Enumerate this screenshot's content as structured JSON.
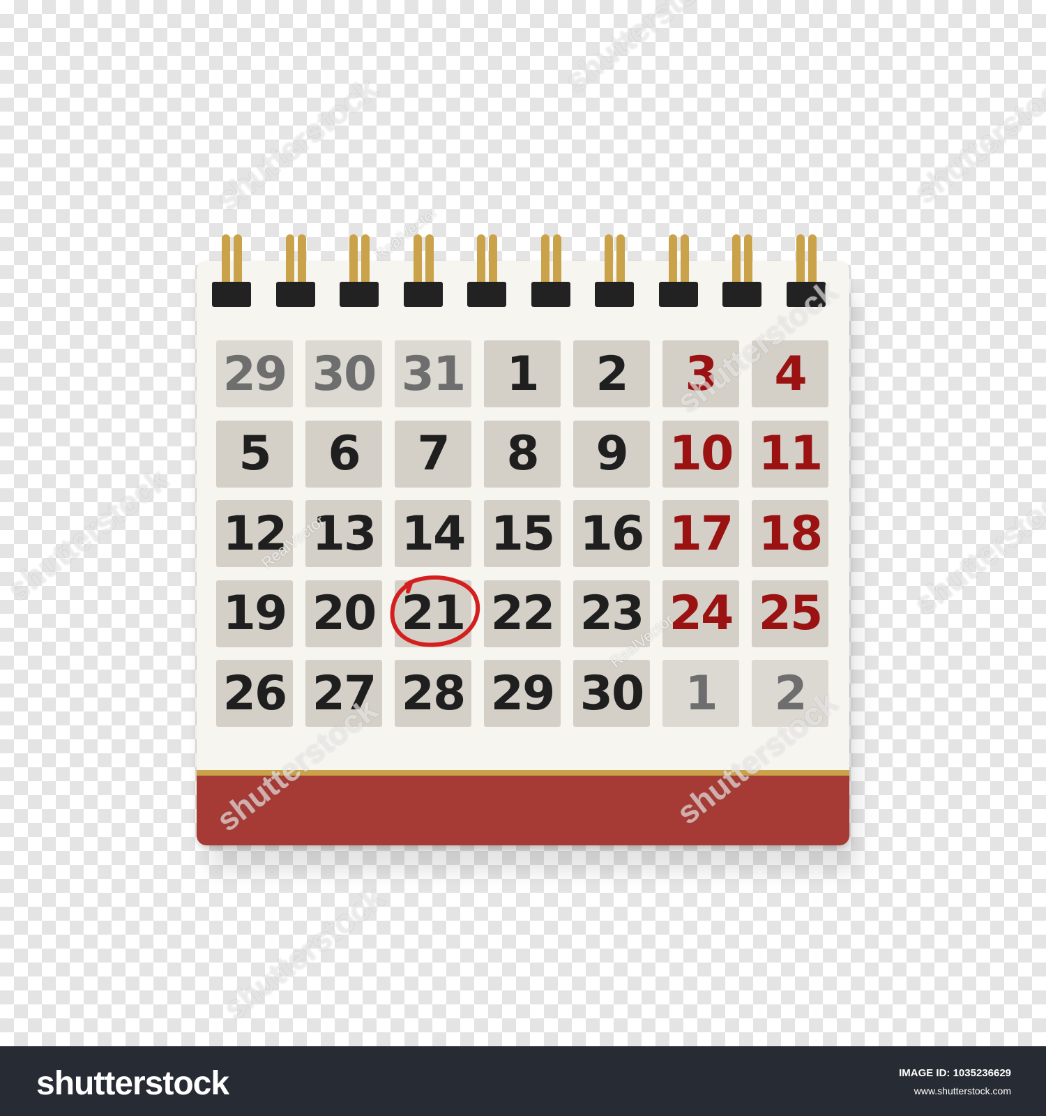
{
  "colors": {
    "paper": "#f7f5f0",
    "cell_bg": "#d4d0c7",
    "cell_bg_dim": "#dcd9d2",
    "text_dark": "#1f1f1f",
    "text_grey": "#6e6e6e",
    "text_red": "#9a1212",
    "ring_gold": "#c9a24a",
    "clip_black": "#222222",
    "footer_red": "#a63a34",
    "gold_line": "#c9a24a",
    "circle_red": "#d41f1f"
  },
  "calendar": {
    "rows": [
      [
        {
          "label": "29",
          "state": "outside"
        },
        {
          "label": "30",
          "state": "outside"
        },
        {
          "label": "31",
          "state": "outside"
        },
        {
          "label": "1",
          "state": "weekday"
        },
        {
          "label": "2",
          "state": "weekday"
        },
        {
          "label": "3",
          "state": "weekend"
        },
        {
          "label": "4",
          "state": "weekend"
        }
      ],
      [
        {
          "label": "5",
          "state": "weekday"
        },
        {
          "label": "6",
          "state": "weekday"
        },
        {
          "label": "7",
          "state": "weekday"
        },
        {
          "label": "8",
          "state": "weekday"
        },
        {
          "label": "9",
          "state": "weekday"
        },
        {
          "label": "10",
          "state": "weekend"
        },
        {
          "label": "11",
          "state": "weekend"
        }
      ],
      [
        {
          "label": "12",
          "state": "weekday"
        },
        {
          "label": "13",
          "state": "weekday"
        },
        {
          "label": "14",
          "state": "weekday"
        },
        {
          "label": "15",
          "state": "weekday"
        },
        {
          "label": "16",
          "state": "weekday"
        },
        {
          "label": "17",
          "state": "weekend"
        },
        {
          "label": "18",
          "state": "weekend"
        }
      ],
      [
        {
          "label": "19",
          "state": "weekday"
        },
        {
          "label": "20",
          "state": "weekday"
        },
        {
          "label": "21",
          "state": "selected"
        },
        {
          "label": "22",
          "state": "weekday"
        },
        {
          "label": "23",
          "state": "weekday"
        },
        {
          "label": "24",
          "state": "weekend"
        },
        {
          "label": "25",
          "state": "weekend"
        }
      ],
      [
        {
          "label": "26",
          "state": "weekday"
        },
        {
          "label": "27",
          "state": "weekday"
        },
        {
          "label": "28",
          "state": "weekday"
        },
        {
          "label": "29",
          "state": "weekday"
        },
        {
          "label": "30",
          "state": "weekday"
        },
        {
          "label": "1",
          "state": "outside"
        },
        {
          "label": "2",
          "state": "outside"
        }
      ]
    ],
    "selected_day": "21",
    "ring_count": 10
  },
  "watermarks": {
    "brand_mark": "shutterstock",
    "contributor": "RealVector"
  },
  "footer": {
    "brand": "shutterstock",
    "image_id": "IMAGE ID: 1035236629",
    "site": "www.shutterstock.com"
  }
}
